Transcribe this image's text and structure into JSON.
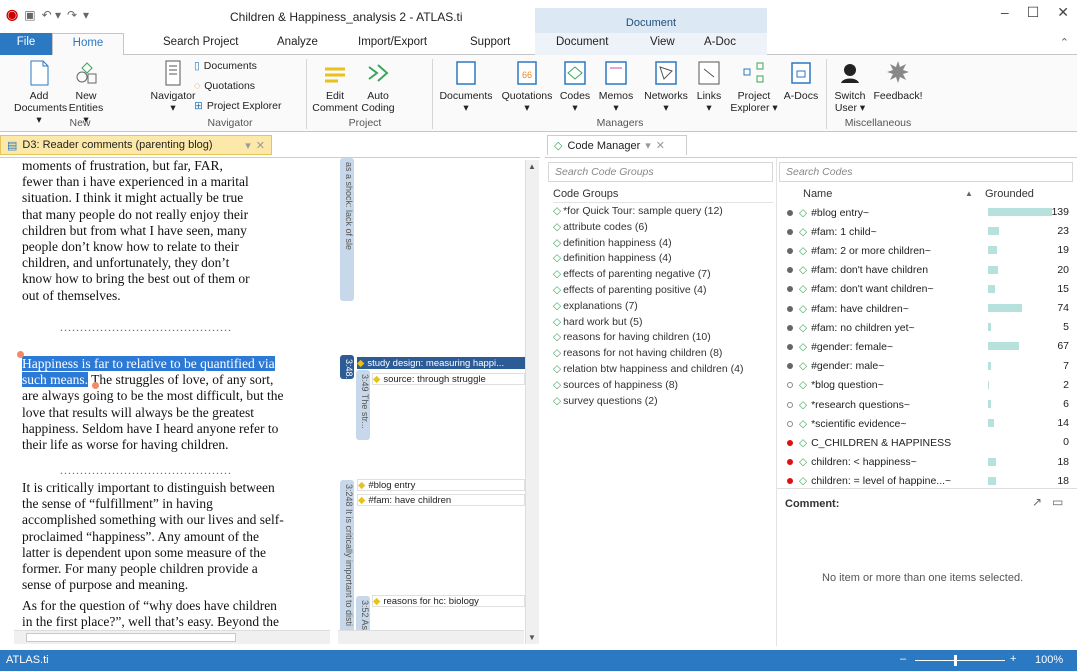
{
  "window": {
    "title": "Children & Happiness_analysis 2 - ATLAS.ti",
    "context_header": "Document"
  },
  "tabs": {
    "file": "File",
    "home": "Home",
    "search": "Search Project",
    "analyze": "Analyze",
    "import": "Import/Export",
    "support": "Support",
    "document": "Document",
    "view": "View",
    "adoc": "A-Doc"
  },
  "ribbon": {
    "add_documents": [
      "Add",
      "Documents ▾"
    ],
    "new_entities": [
      "New",
      "Entities ▾"
    ],
    "navigator": [
      "Navigator",
      "▾"
    ],
    "nav_items": [
      "Documents",
      "Quotations",
      "Project Explorer"
    ],
    "edit_comment": [
      "Edit",
      "Comment"
    ],
    "auto_coding": [
      "Auto",
      "Coding"
    ],
    "managers": [
      "Documents",
      "Quotations",
      "Codes",
      "Memos",
      "Networks",
      "Links"
    ],
    "project_explorer": [
      "Project",
      "Explorer ▾"
    ],
    "adocs": "A-Docs",
    "switch_user": [
      "Switch",
      "User ▾"
    ],
    "feedback": "Feedback!",
    "groups": {
      "new": "New",
      "navigator": "Navigator",
      "project": "Project",
      "managers": "Managers",
      "misc": "Miscellaneous"
    }
  },
  "doc_tab": "D3: Reader comments (parenting blog)",
  "cm_tab": "Code Manager",
  "doc_text": {
    "p1": [
      "moments of frustration, but far, FAR,",
      "fewer than i have experienced in a marital",
      "situation. I think it might actually be true",
      "that many people do not really enjoy their",
      "children but from what I have seen, many",
      "people don’t know how to relate to their",
      "children, and unfortunately, they don’t",
      "know how to bring the best out of them or",
      "out of themselves."
    ],
    "dots": "...........................................",
    "p2_hl1": "Happiness is far to relative to be quantified via",
    "p2_hl2": "such means.",
    "p2_rest1": " The struggles of love, of any sort,",
    "p2": [
      "are always going to be the most difficult, but the",
      "love that results will always be the greatest",
      "happiness. Seldom have I heard anyone refer to",
      "their life as worse for having children."
    ],
    "p3": [
      "It is critically important to distinguish between",
      "the sense of “fulfillment” in having",
      "accomplished something with our lives and self-",
      "proclaimed “happiness”. Any amount of the",
      "latter is dependent upon some measure of the",
      "former. For many people children provide a",
      "sense of purpose and meaning."
    ],
    "p4": [
      "As for the question of “why does have children",
      "in the first place?”, well that’s easy. Beyond the"
    ]
  },
  "margin": {
    "bar1": "as a shock: lack of sle",
    "bar2": "3:48...",
    "bar3": "3:49 The str...",
    "bar4": "3:248 It is critically important to disti",
    "bar5": "3:52 As",
    "codes": [
      "study design: measuring happi...",
      "source: through struggle",
      "#blog entry",
      "#fam: have children",
      "reasons for hc: biology"
    ]
  },
  "code_groups": {
    "search_placeholder": "Search Code Groups",
    "header": "Code Groups",
    "items": [
      "*for Quick Tour: sample query (12)",
      "attribute codes (6)",
      "definition happiness (4)",
      "definition happiness (4)",
      "effects of parenting negative (7)",
      "effects of parenting positive (4)",
      "explanations (7)",
      "hard work but (5)",
      "reasons for having children (10)",
      "reasons for not having children (8)",
      "relation btw happiness and children (4)",
      "sources of happiness (8)",
      "survey questions (2)"
    ]
  },
  "codes": {
    "search_placeholder": "Search Codes",
    "col_name": "Name",
    "col_grounded": "Grounded",
    "items": [
      {
        "name": "#blog entry~",
        "grounded": "139",
        "fill": 1.0,
        "dot": "#666"
      },
      {
        "name": "#fam: 1 child~",
        "grounded": "23",
        "fill": 0.17,
        "dot": "#666"
      },
      {
        "name": "#fam: 2 or more  children~",
        "grounded": "19",
        "fill": 0.14,
        "dot": "#666"
      },
      {
        "name": "#fam: don't have children",
        "grounded": "20",
        "fill": 0.15,
        "dot": "#666"
      },
      {
        "name": "#fam: don't want children~",
        "grounded": "15",
        "fill": 0.11,
        "dot": "#666"
      },
      {
        "name": "#fam: have children~",
        "grounded": "74",
        "fill": 0.53,
        "dot": "#666"
      },
      {
        "name": "#fam: no children yet~",
        "grounded": "5",
        "fill": 0.04,
        "dot": "#666"
      },
      {
        "name": "#gender: female~",
        "grounded": "67",
        "fill": 0.48,
        "dot": "#666"
      },
      {
        "name": "#gender: male~",
        "grounded": "7",
        "fill": 0.05,
        "dot": "#666"
      },
      {
        "name": "*blog question~",
        "grounded": "2",
        "fill": 0.02,
        "dot": "hollow"
      },
      {
        "name": "*research questions~",
        "grounded": "6",
        "fill": 0.05,
        "dot": "hollow"
      },
      {
        "name": "*scientific evidence~",
        "grounded": "14",
        "fill": 0.1,
        "dot": "hollow"
      },
      {
        "name": "C_CHILDREN & HAPPINESS",
        "grounded": "0",
        "fill": 0,
        "dot": "#e01010"
      },
      {
        "name": "children: < happiness~",
        "grounded": "18",
        "fill": 0.13,
        "dot": "#e01010"
      },
      {
        "name": "children: = level of happine...~",
        "grounded": "18",
        "fill": 0.13,
        "dot": "#e01010"
      }
    ],
    "comment_label": "Comment:",
    "comment_empty": "No item or more than one items selected."
  },
  "status": {
    "app": "ATLAS.ti",
    "zoom": "100%"
  }
}
